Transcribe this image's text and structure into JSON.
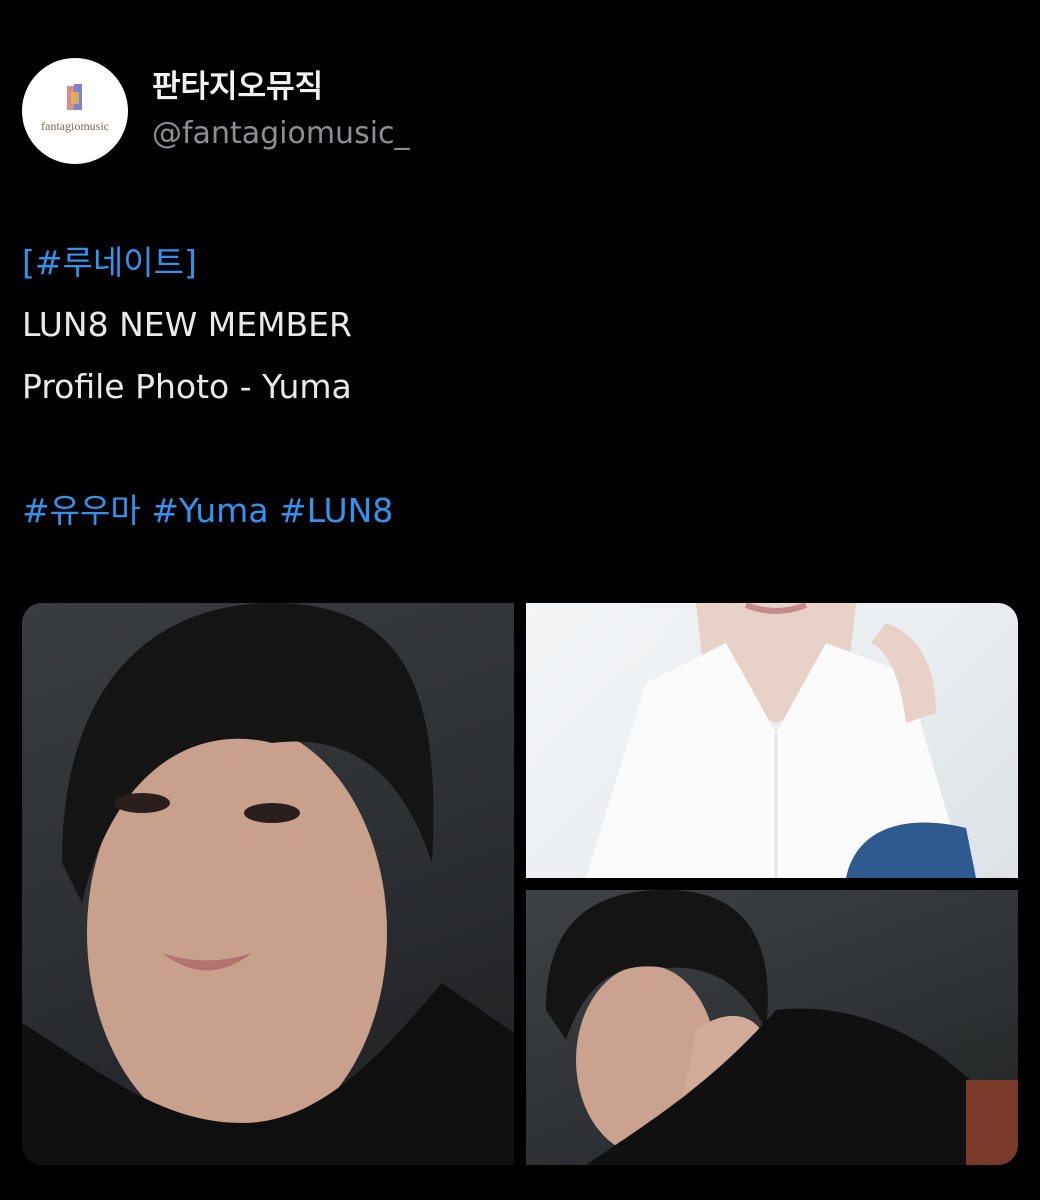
{
  "account": {
    "display_name": "판타지오뮤직",
    "handle": "@fantagiomusic_",
    "avatar_wordmark": "fantagiomusic"
  },
  "tweet": {
    "hashtag_bracket_open": "[",
    "hashtag_bracket": "#루네이트",
    "hashtag_bracket_close": "]",
    "line1": "LUN8 NEW MEMBER",
    "line2": "Profile Photo - Yuma",
    "hashtags": [
      "#유우마",
      "#Yuma",
      "#LUN8"
    ]
  },
  "media": {
    "photos": [
      {
        "icon": "portrait-photo"
      },
      {
        "icon": "portrait-photo"
      },
      {
        "icon": "portrait-photo"
      }
    ]
  },
  "colors": {
    "background": "#000000",
    "link": "#2f93f0",
    "handle": "#8b8f95"
  }
}
